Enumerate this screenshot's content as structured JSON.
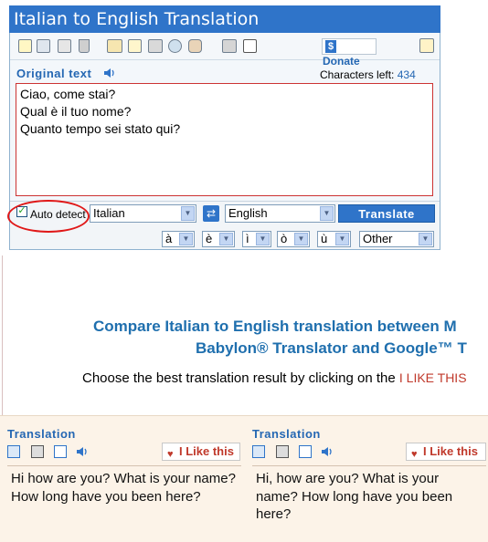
{
  "app": {
    "title": "Italian to English Translation"
  },
  "toolbar": {
    "icons": [
      "new-document-icon",
      "open-icon",
      "cut-icon",
      "delete-icon",
      "dictionary-icon",
      "spellcheck-icon",
      "keyboard-icon",
      "tools-icon",
      "speak-icon",
      "print-icon",
      "help-icon"
    ],
    "donate_label": "Donate",
    "donate_symbol": "$",
    "right_icon": "resize-icon"
  },
  "source": {
    "label": "Original text",
    "chars_left_label": "Characters left:",
    "chars_left_value": "434",
    "text": "Ciao, come stai?\nQual è il tuo nome?\nQuanto tempo sei stato qui?"
  },
  "controls": {
    "auto_detect_label": "Auto detect",
    "auto_detect_checked": "✓",
    "source_language": "Italian",
    "target_language": "English",
    "translate_label": "Translate",
    "swap_symbol": "⇄",
    "accents": [
      "à",
      "è",
      "ì",
      "ò",
      "ù"
    ],
    "accent_other": "Other"
  },
  "compare": {
    "line1": "Compare Italian to English translation between M",
    "line2": "Babylon® Translator and Google™ T",
    "choose_text": "Choose the best translation result by clicking on the",
    "choose_highlight": "I LIKE THIS"
  },
  "results": [
    {
      "title": "Translation",
      "like_label": "I Like this",
      "text": "Hi how are you? What is your name? How long have you been here?"
    },
    {
      "title": "Translation",
      "like_label": "I Like this",
      "text": "Hi, how are you? What is your name? How long have you been here?"
    }
  ],
  "colors": {
    "accent": "#2f74c9",
    "link_blue": "#1f6fae",
    "highlight_red": "#e01818",
    "results_bg": "#fcf3e8"
  }
}
